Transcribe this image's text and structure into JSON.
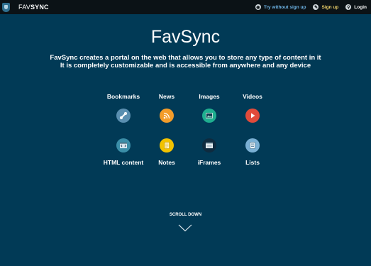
{
  "topbar": {
    "brand_fav": "FAV",
    "brand_sync": "SYNC",
    "actions": [
      {
        "label": "Try without sign up",
        "icon": "eye-icon",
        "color": "#6fb6e8"
      },
      {
        "label": "Sign up",
        "icon": "pencil-icon",
        "color": "#f0d36a"
      },
      {
        "label": "Login",
        "icon": "key-icon",
        "color": "#ffffff"
      }
    ]
  },
  "hero": {
    "title": "FavSync",
    "line1": "FavSync creates a portal on the web that allows you to store any type of content in it",
    "line2": "It is completely customizable and is accessible from anywhere and any device"
  },
  "categories": [
    {
      "label": "Bookmarks",
      "icon": "link-icon",
      "color": "#5a8fb0"
    },
    {
      "label": "News",
      "icon": "rss-icon",
      "color": "#f39c2a"
    },
    {
      "label": "Images",
      "icon": "image-icon",
      "color": "#1fae8f"
    },
    {
      "label": "Videos",
      "icon": "play-icon",
      "color": "#e14b3b"
    },
    {
      "label": "HTML content",
      "icon": "code-window-icon",
      "color": "#3b8ea8"
    },
    {
      "label": "Notes",
      "icon": "notepad-icon",
      "color": "#f2c200"
    },
    {
      "label": "iFrames",
      "icon": "browser-frame-icon",
      "color": "#0e2b3f"
    },
    {
      "label": "Lists",
      "icon": "list-icon",
      "color": "#7ab0d4"
    }
  ],
  "scroll": {
    "label": "SCROLL DOWN"
  },
  "colors": {
    "background": "#013a56",
    "topbar": "#0b1216"
  }
}
